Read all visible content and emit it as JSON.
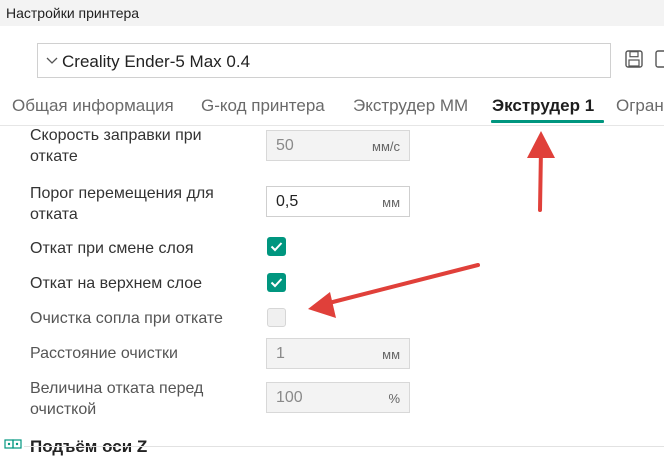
{
  "window": {
    "title": "Настройки принтера"
  },
  "preset": {
    "value": "Creality Ender-5 Max 0.4"
  },
  "tabs": [
    {
      "label": "Общая информация"
    },
    {
      "label": "G-код принтера"
    },
    {
      "label": "Экструдер ММ"
    },
    {
      "label": "Экструдер 1"
    },
    {
      "label": "Огран"
    }
  ],
  "settings": {
    "refill_speed": {
      "label_line1": "Скорость заправки при",
      "label_line2": "откате",
      "value": "50",
      "unit": "мм/с"
    },
    "travel_threshold": {
      "label_line1": "Порог перемещения для",
      "label_line2": "отката",
      "value": "0,5",
      "unit": "мм"
    },
    "retract_layer_change": {
      "label": "Откат при смене слоя",
      "checked": true
    },
    "retract_top_layer": {
      "label": "Откат на верхнем слое",
      "checked": true
    },
    "wipe_on_retract": {
      "label": "Очистка сопла при откате",
      "checked": false
    },
    "wipe_distance": {
      "label": "Расстояние очистки",
      "value": "1",
      "unit": "мм"
    },
    "retract_before_wipe": {
      "label_line1": "Величина отката перед",
      "label_line2": "очисткой",
      "value": "100",
      "unit": "%"
    }
  },
  "section": {
    "title": "Подъём оси Z"
  },
  "colors": {
    "accent": "#00967f",
    "arrow": "#e0403a"
  }
}
